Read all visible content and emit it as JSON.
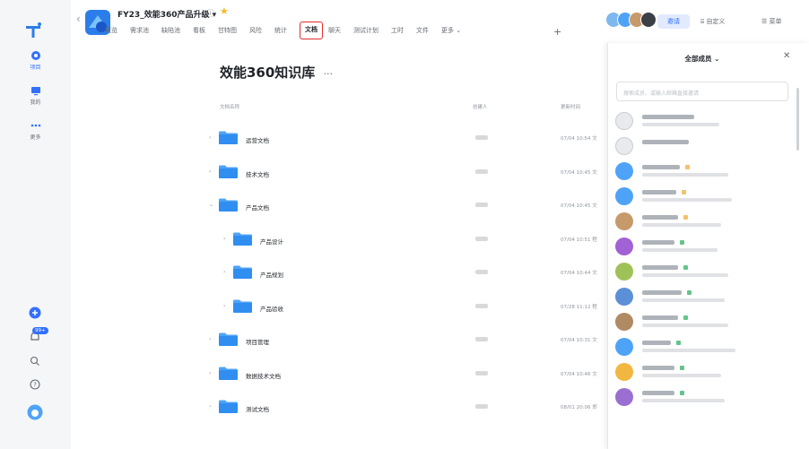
{
  "project": {
    "name": "FY23_效能360产品升级",
    "name_suffix": "▾",
    "extra": "ⓘ",
    "star": "★"
  },
  "tabs": [
    {
      "label": "概览"
    },
    {
      "label": "需求池"
    },
    {
      "label": "缺陷池"
    },
    {
      "label": "看板"
    },
    {
      "label": "甘特图"
    },
    {
      "label": "风险"
    },
    {
      "label": "统计"
    },
    {
      "label": "文档",
      "active": true
    },
    {
      "label": "聊天"
    },
    {
      "label": "测试计划"
    },
    {
      "label": "工时"
    },
    {
      "label": "文件"
    },
    {
      "label": "更多 ⌄"
    }
  ],
  "header": {
    "plus": "+",
    "invite": "邀请",
    "customize": "自定义",
    "menu": "菜单"
  },
  "rail": {
    "items": [
      {
        "label": "项目"
      },
      {
        "label": "我的"
      },
      {
        "label": "更多"
      }
    ],
    "badge": "99+"
  },
  "main": {
    "title": "效能360知识库",
    "title_more": "···",
    "columns": {
      "name": "文档名称",
      "creator": "创建人",
      "updated": "更新时间"
    },
    "rows": [
      {
        "name": "运营文档",
        "updated": "07/04 10:54 文"
      },
      {
        "name": "技术文档",
        "updated": "07/04 10:45 文"
      },
      {
        "name": "产品文档",
        "updated": "07/04 10:45 文",
        "expanded": true
      },
      {
        "name": "产品设计",
        "updated": "07/04 10:51 程",
        "child": true
      },
      {
        "name": "产品规划",
        "updated": "07/04 10:44 文",
        "child": true
      },
      {
        "name": "产品验收",
        "updated": "07/28 11:12 程",
        "child": true
      },
      {
        "name": "项目管理",
        "updated": "07/04 10:31 文"
      },
      {
        "name": "数据技术文档",
        "updated": "07/04 10:46 文"
      },
      {
        "name": "测试文档",
        "updated": "08/01 20:06 郑"
      }
    ]
  },
  "panel": {
    "title": "全部成员 ⌄",
    "close": "✕",
    "search_placeholder": "搜索成员、或输入邮箱直接邀请"
  },
  "colors": {
    "accent": "#3370ff",
    "folder": "#4fa3f7",
    "highlight": "#e02d2d"
  }
}
